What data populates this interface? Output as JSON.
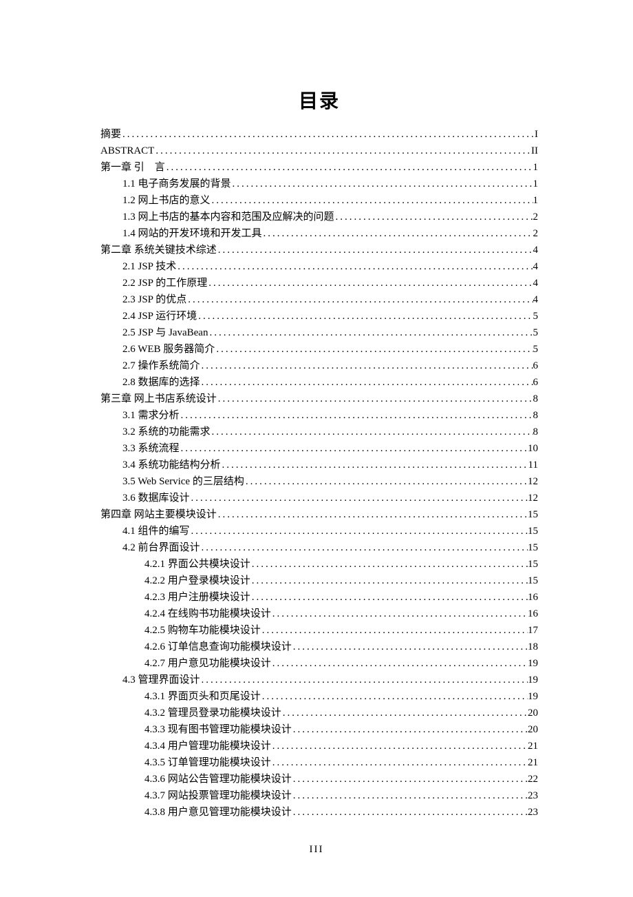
{
  "title": "目录",
  "page_number": "III",
  "entries": [
    {
      "level": 0,
      "label": "摘要",
      "page": "I"
    },
    {
      "level": 0,
      "label": "ABSTRACT",
      "page": "II"
    },
    {
      "level": 0,
      "label": "第一章  引　言",
      "page": "1"
    },
    {
      "level": 1,
      "label": "1.1  电子商务发展的背景",
      "page": "1"
    },
    {
      "level": 1,
      "label": "1.2  网上书店的意义",
      "page": "1"
    },
    {
      "level": 1,
      "label": "1.3  网上书店的基本内容和范围及应解决的问题",
      "page": "2"
    },
    {
      "level": 1,
      "label": "1.4  网站的开发环境和开发工具",
      "page": "2"
    },
    {
      "level": 0,
      "label": "第二章  系统关键技术综述",
      "page": "4"
    },
    {
      "level": 1,
      "label": "2.1  JSP 技术",
      "page": "4"
    },
    {
      "level": 1,
      "label": "2.2  JSP 的工作原理",
      "page": "4"
    },
    {
      "level": 1,
      "label": "2.3  JSP 的优点",
      "page": "4"
    },
    {
      "level": 1,
      "label": "2.4  JSP 运行环境",
      "page": "5"
    },
    {
      "level": 1,
      "label": "2.5  JSP 与 JavaBean",
      "page": "5"
    },
    {
      "level": 1,
      "label": "2.6  WEB 服务器简介",
      "page": "5"
    },
    {
      "level": 1,
      "label": "2.7  操作系统简介",
      "page": "6"
    },
    {
      "level": 1,
      "label": "2.8  数据库的选择",
      "page": "6"
    },
    {
      "level": 0,
      "label": "第三章  网上书店系统设计",
      "page": "8"
    },
    {
      "level": 1,
      "label": "3.1  需求分析",
      "page": "8"
    },
    {
      "level": 1,
      "label": "3.2  系统的功能需求",
      "page": "8"
    },
    {
      "level": 1,
      "label": "3.3  系统流程",
      "page": "10"
    },
    {
      "level": 1,
      "label": "3.4  系统功能结构分析",
      "page": "11"
    },
    {
      "level": 1,
      "label": "3.5  Web Service 的三层结构",
      "page": "12"
    },
    {
      "level": 1,
      "label": "3.6  数据库设计",
      "page": "12"
    },
    {
      "level": 0,
      "label": "第四章    网站主要模块设计",
      "page": "15"
    },
    {
      "level": 1,
      "label": "4.1  组件的编写",
      "page": "15"
    },
    {
      "level": 1,
      "label": "4.2  前台界面设计",
      "page": "15"
    },
    {
      "level": 2,
      "label": "4.2.1  界面公共模块设计",
      "page": "15"
    },
    {
      "level": 2,
      "label": "4.2.2  用户登录模块设计",
      "page": "15"
    },
    {
      "level": 2,
      "label": "4.2.3   用户注册模块设计",
      "page": "16"
    },
    {
      "level": 2,
      "label": "4.2.4   在线购书功能模块设计",
      "page": "16"
    },
    {
      "level": 2,
      "label": "4.2.5   购物车功能模块设计",
      "page": "17"
    },
    {
      "level": 2,
      "label": "4.2.6   订单信息查询功能模块设计",
      "page": "18"
    },
    {
      "level": 2,
      "label": "4.2.7   用户意见功能模块设计",
      "page": "19"
    },
    {
      "level": 1,
      "label": "4.3  管理界面设计",
      "page": "19"
    },
    {
      "level": 2,
      "label": "4.3.1  界面页头和页尾设计",
      "page": "19"
    },
    {
      "level": 2,
      "label": "4.3.2   管理员登录功能模块设计",
      "page": "20"
    },
    {
      "level": 2,
      "label": "4.3.3   现有图书管理功能模块设计",
      "page": "20"
    },
    {
      "level": 2,
      "label": "4.3.4   用户管理功能模块设计",
      "page": "21"
    },
    {
      "level": 2,
      "label": "4.3.5   订单管理功能模块设计",
      "page": "21"
    },
    {
      "level": 2,
      "label": "4.3.6   网站公告管理功能模块设计",
      "page": "22"
    },
    {
      "level": 2,
      "label": "4.3.7   网站投票管理功能模块设计",
      "page": "23"
    },
    {
      "level": 2,
      "label": "4.3.8   用户意见管理功能模块设计",
      "page": "23"
    }
  ]
}
